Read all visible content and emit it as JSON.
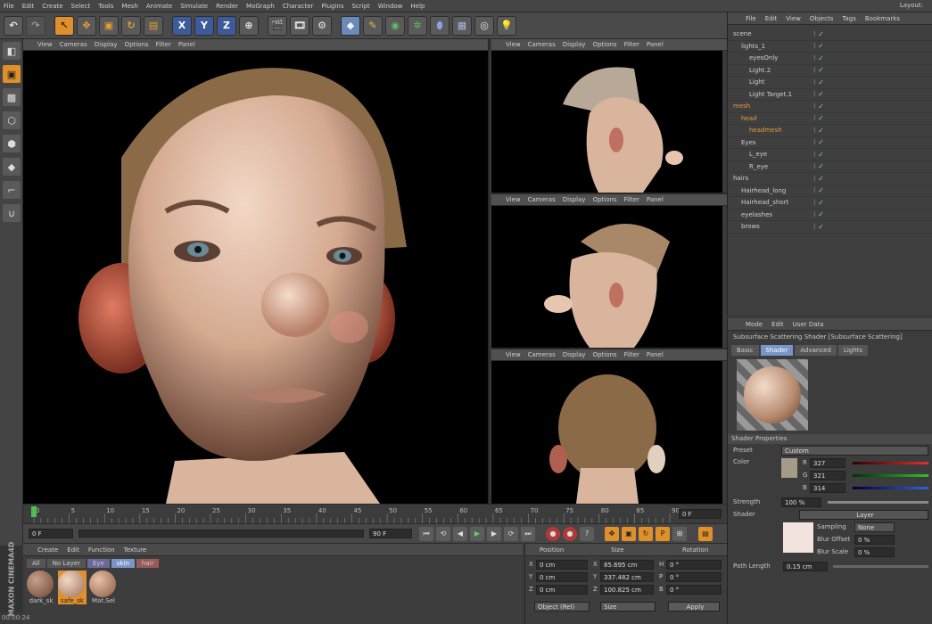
{
  "menu": [
    "File",
    "Edit",
    "Create",
    "Select",
    "Tools",
    "Mesh",
    "Animate",
    "Simulate",
    "Render",
    "MoGraph",
    "Character",
    "Plugins",
    "Script",
    "Window",
    "Help"
  ],
  "layout_label": "Layout:",
  "toolbar": {
    "x_label": "X",
    "y_label": "Y",
    "z_label": "Z"
  },
  "viewport_menu": [
    "View",
    "Cameras",
    "Display",
    "Options",
    "Filter",
    "Panel"
  ],
  "object_manager": {
    "menu": [
      "File",
      "Edit",
      "View",
      "Objects",
      "Tags",
      "Bookmarks"
    ],
    "objects": [
      {
        "name": "scene",
        "indent": 0,
        "highlight": false
      },
      {
        "name": "lights_1",
        "indent": 1,
        "highlight": false
      },
      {
        "name": "eyesOnly",
        "indent": 2,
        "highlight": false
      },
      {
        "name": "Light.2",
        "indent": 2,
        "highlight": false
      },
      {
        "name": "Light",
        "indent": 2,
        "highlight": false
      },
      {
        "name": "Light Target.1",
        "indent": 2,
        "highlight": false
      },
      {
        "name": "mesh",
        "indent": 0,
        "highlight": true
      },
      {
        "name": "head",
        "indent": 1,
        "highlight": true
      },
      {
        "name": "headmesh",
        "indent": 2,
        "highlight": true
      },
      {
        "name": "Eyes",
        "indent": 1,
        "highlight": false
      },
      {
        "name": "L_eye",
        "indent": 2,
        "highlight": false
      },
      {
        "name": "R_eye",
        "indent": 2,
        "highlight": false
      },
      {
        "name": "hairs",
        "indent": 0,
        "highlight": false
      },
      {
        "name": "Hairhead_long",
        "indent": 1,
        "highlight": false
      },
      {
        "name": "Hairhead_short",
        "indent": 1,
        "highlight": false
      },
      {
        "name": "eyelashes",
        "indent": 1,
        "highlight": false
      },
      {
        "name": "brows",
        "indent": 1,
        "highlight": false
      }
    ]
  },
  "attributes": {
    "menu": [
      "Mode",
      "Edit",
      "User Data"
    ],
    "title": "Subsurface Scattering Shader [Subsurface Scattering]",
    "tabs": [
      "Basic",
      "Shader",
      "Advanced",
      "Lights"
    ],
    "section": "Shader Properties",
    "preset_label": "Preset",
    "preset_value": "Custom",
    "color_label": "Color",
    "r": "327",
    "g": "321",
    "b": "314",
    "r_label": "R",
    "g_label": "G",
    "b_label": "B",
    "strength_label": "Strength",
    "strength_value": "100 %",
    "shader_label": "Shader",
    "layer_label": "Layer",
    "sampling_label": "Sampling",
    "sampling_value": "None",
    "blur_offset_label": "Blur Offset",
    "blur_offset_value": "0 %",
    "blur_scale_label": "Blur Scale",
    "blur_scale_value": "0 %",
    "path_length_label": "Path Length",
    "path_length_value": "0.15 cm"
  },
  "timeline": {
    "ticks": [
      "0",
      "5",
      "10",
      "15",
      "20",
      "25",
      "30",
      "35",
      "40",
      "45",
      "50",
      "55",
      "60",
      "65",
      "70",
      "75",
      "80",
      "85",
      "90"
    ],
    "end_frame": "0 F",
    "current_frame": "0 F",
    "max_frame": "90 F"
  },
  "materials": {
    "menu": [
      "Create",
      "Edit",
      "Function",
      "Texture"
    ],
    "filters": [
      "All",
      "No Layer",
      "Eye",
      "skin",
      "hair"
    ],
    "items": [
      "dark_sk",
      "safe_sk",
      "Mat.Sel"
    ]
  },
  "coordinates": {
    "headers": [
      "Position",
      "Size",
      "Rotation"
    ],
    "rows": [
      {
        "axis": "X",
        "pos": "0 cm",
        "size_axis": "X",
        "size": "85.695 cm",
        "rot_axis": "H",
        "rot": "0 °"
      },
      {
        "axis": "Y",
        "pos": "0 cm",
        "size_axis": "Y",
        "size": "337.482 cm",
        "rot_axis": "P",
        "rot": "0 °"
      },
      {
        "axis": "Z",
        "pos": "0 cm",
        "size_axis": "Z",
        "size": "100.825 cm",
        "rot_axis": "B",
        "rot": "0 °"
      }
    ],
    "mode": "Object (Rel)",
    "size_mode": "Size",
    "apply": "Apply"
  },
  "brand": "MAXON CINEMA4D",
  "status_time": "00:00:24",
  "colors": {
    "accent": "#e0902a",
    "tab_active": "#7a96c8",
    "skin": "#d9b9a0"
  }
}
